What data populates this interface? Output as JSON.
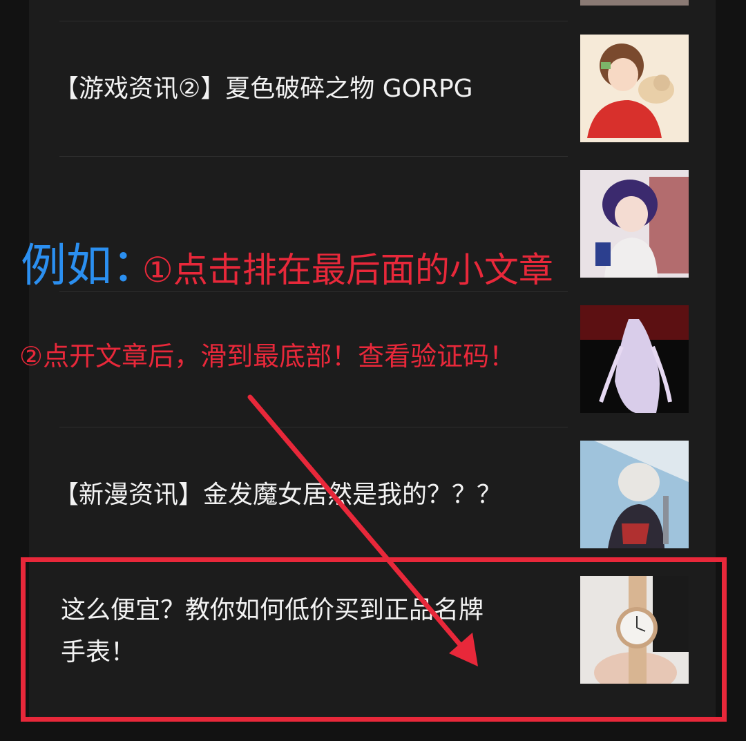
{
  "articles": [
    {
      "title": "【游戏资讯②】夏色破碎之物 GORPG",
      "image": "anime-girl-red-dress-with-dog"
    },
    {
      "title": "",
      "image": "anime-girl-purple-hair"
    },
    {
      "title": "",
      "image": "white-haired-figure-dark-red-background"
    },
    {
      "title": "【新漫资讯】金发魔女居然是我的？？？",
      "image": "anime-girl-silver-hair-sword"
    },
    {
      "title_line1": "这么便宜？教你如何低价买到正品名牌",
      "title_line2": "手表！",
      "image": "wristwatch-in-hand"
    }
  ],
  "annotation": {
    "example_label": "例如：",
    "step1": "①点击排在最后面的小文章",
    "step2": "②点开文章后，滑到最底部！查看验证码！"
  },
  "colors": {
    "background": "#121212",
    "panel": "#1c1c1c",
    "text": "#f2f2f2",
    "annotation_blue": "#2b8ff0",
    "annotation_red": "#e8283a"
  }
}
